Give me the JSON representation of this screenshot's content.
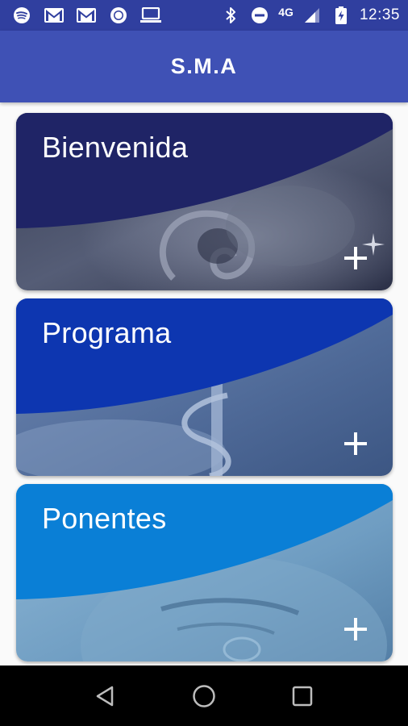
{
  "status_bar": {
    "time": "12:35",
    "network": "4G",
    "left_icons": [
      "spotify-icon",
      "gmail-icon",
      "gmail-icon",
      "circle-app-icon",
      "laptop-icon"
    ],
    "right_icons": [
      "bluetooth-icon",
      "do-not-disturb-icon",
      "signal-icon",
      "battery-charging-icon"
    ]
  },
  "app_bar": {
    "title": "S.M.A",
    "color": "#3f51b5",
    "status_color": "#303f9f"
  },
  "cards": [
    {
      "title": "Bienvenida",
      "top_color": "#1f2466",
      "image_tone": "#4a5470",
      "action_icon": "plus-icon"
    },
    {
      "title": "Programa",
      "top_color": "#0d36b0",
      "image_tone": "#5a74a0",
      "action_icon": "plus-icon"
    },
    {
      "title": "Ponentes",
      "top_color": "#0a7fd6",
      "image_tone": "#6a9cc0",
      "action_icon": "plus-icon"
    }
  ],
  "nav_bar": {
    "buttons": [
      "back-icon",
      "home-icon",
      "recents-icon"
    ]
  }
}
